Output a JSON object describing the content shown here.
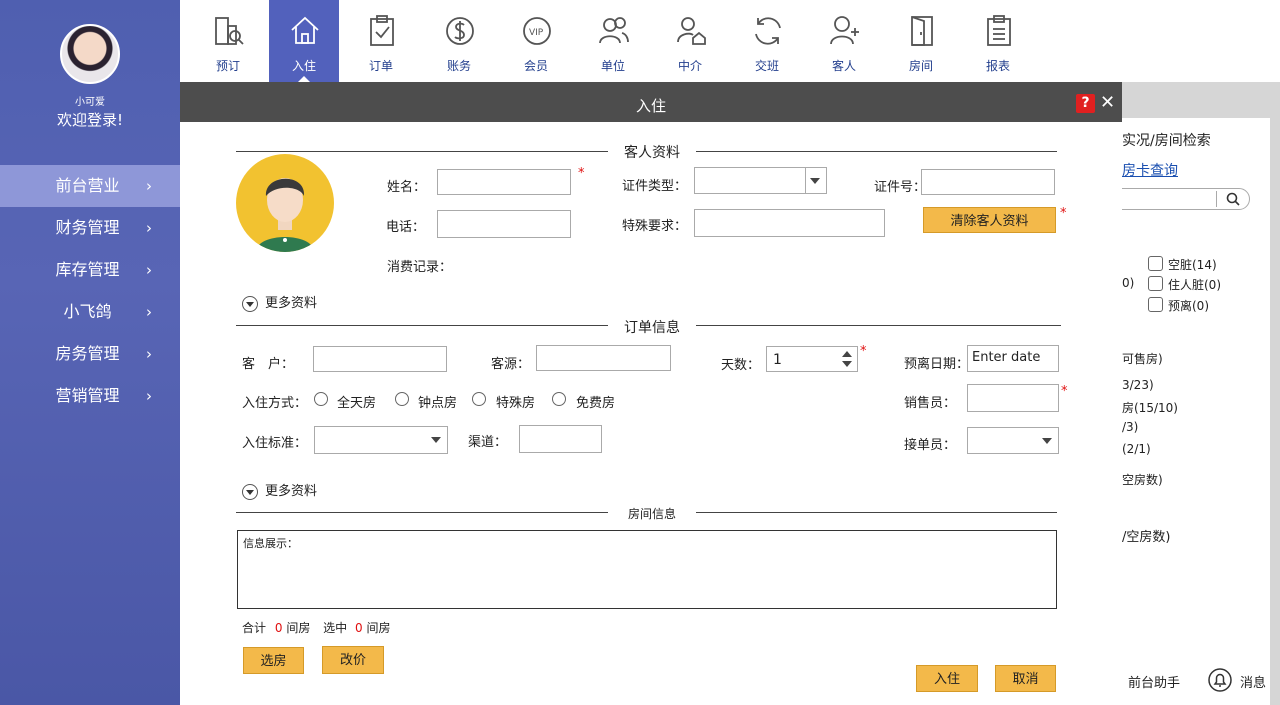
{
  "sidebar": {
    "user_name": "小可爱",
    "welcome": "欢迎登录!",
    "items": [
      {
        "label": "前台营业"
      },
      {
        "label": "财务管理"
      },
      {
        "label": "库存管理"
      },
      {
        "label": "小飞鸽"
      },
      {
        "label": "房务管理"
      },
      {
        "label": "营销管理"
      }
    ],
    "chevron": "›"
  },
  "toolbar": {
    "items": [
      {
        "label": "预订",
        "icon": "building-search-icon"
      },
      {
        "label": "入住",
        "icon": "house-icon"
      },
      {
        "label": "订单",
        "icon": "clipboard-check-icon"
      },
      {
        "label": "账务",
        "icon": "dollar-icon"
      },
      {
        "label": "会员",
        "icon": "vip-icon"
      },
      {
        "label": "单位",
        "icon": "group-icon"
      },
      {
        "label": "中介",
        "icon": "agent-icon"
      },
      {
        "label": "交班",
        "icon": "refresh-icon"
      },
      {
        "label": "客人",
        "icon": "user-add-icon"
      },
      {
        "label": "房间",
        "icon": "door-icon"
      },
      {
        "label": "报表",
        "icon": "report-icon"
      }
    ]
  },
  "dialog": {
    "title": "入住",
    "help": "?",
    "close": "✕",
    "guest": {
      "section": "客人资料",
      "name_label": "姓名：",
      "id_type_label": "证件类型：",
      "id_no_label": "证件号：",
      "phone_label": "电话：",
      "special_label": "特殊要求：",
      "clear_button": "清除客人资料",
      "history_label": "消费记录：",
      "required": "*"
    },
    "more_info": "更多资料",
    "order": {
      "section": "订单信息",
      "customer_label": "客　户：",
      "source_label": "客源：",
      "days_label": "天数：",
      "days_value": "1",
      "checkout_label": "预离日期：",
      "checkout_placeholder": "Enter date",
      "mode_label": "入住方式：",
      "modes": [
        "全天房",
        "钟点房",
        "特殊房",
        "免费房"
      ],
      "seller_label": "销售员：",
      "standard_label": "入住标准：",
      "channel_label": "渠道：",
      "taker_label": "接单员："
    },
    "room": {
      "section": "房间信息",
      "info_label": "信息展示：",
      "total_prefix": "合计",
      "total_value": "0",
      "unit": "间房",
      "selected_prefix": "选中",
      "selected_value": "0"
    },
    "buttons": {
      "select_room": "选房",
      "change_price": "改价",
      "checkin": "入住",
      "cancel": "取消"
    }
  },
  "right_panel": {
    "title": "实况/房间检索",
    "link": "房卡查询",
    "status_items": [
      "空脏(14)",
      "住人脏(0)",
      "预离(0)"
    ],
    "partial_left": "0)",
    "lines": [
      "可售房)",
      "3/23)",
      "房(15/10)",
      "/3)",
      "(2/1)",
      "空房数)",
      "/空房数)"
    ],
    "assistant": "前台助手",
    "messages": "消息"
  }
}
